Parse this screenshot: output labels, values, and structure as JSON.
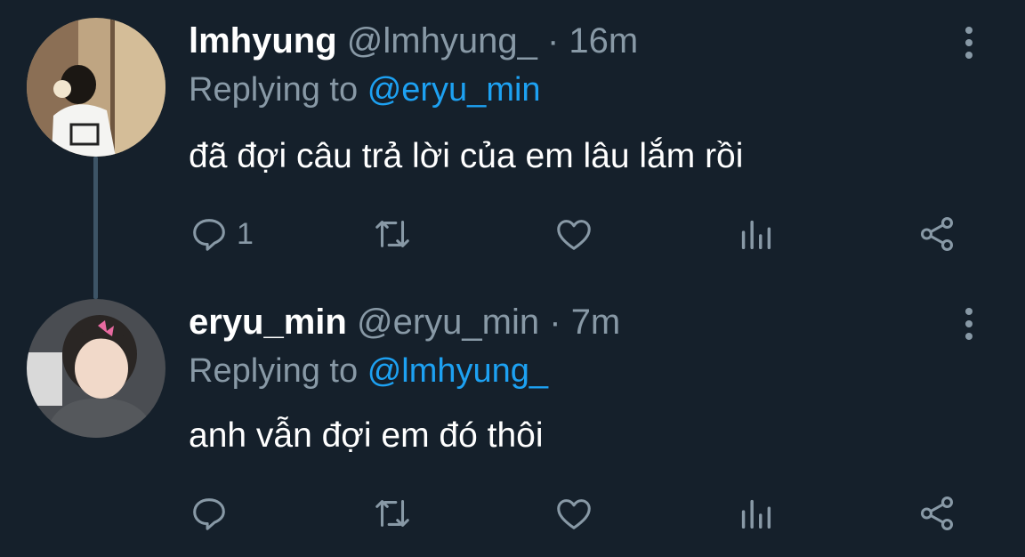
{
  "tweets": [
    {
      "name": "lmhyung",
      "handle": "@lmhyung_",
      "separator": "·",
      "time": "16m",
      "replying_prefix": "Replying to",
      "replying_to": "@eryu_min",
      "text": "đã đợi câu trả lời của em lâu lắm rồi",
      "reply_count": "1"
    },
    {
      "name": "eryu_min",
      "handle": "@eryu_min",
      "separator": "·",
      "time": "7m",
      "replying_prefix": "Replying to",
      "replying_to": "@lmhyung_",
      "text": "anh vẫn đợi em đó thôi",
      "reply_count": ""
    }
  ],
  "icons": {
    "reply": "reply-icon",
    "retweet": "retweet-icon",
    "like": "heart-icon",
    "analytics": "analytics-icon",
    "share": "share-icon",
    "more": "more-vertical-icon"
  },
  "colors": {
    "background": "#15202b",
    "text": "#ffffff",
    "secondary": "#8899a6",
    "accent": "#1da1f2",
    "thread_line": "#3d5466"
  }
}
